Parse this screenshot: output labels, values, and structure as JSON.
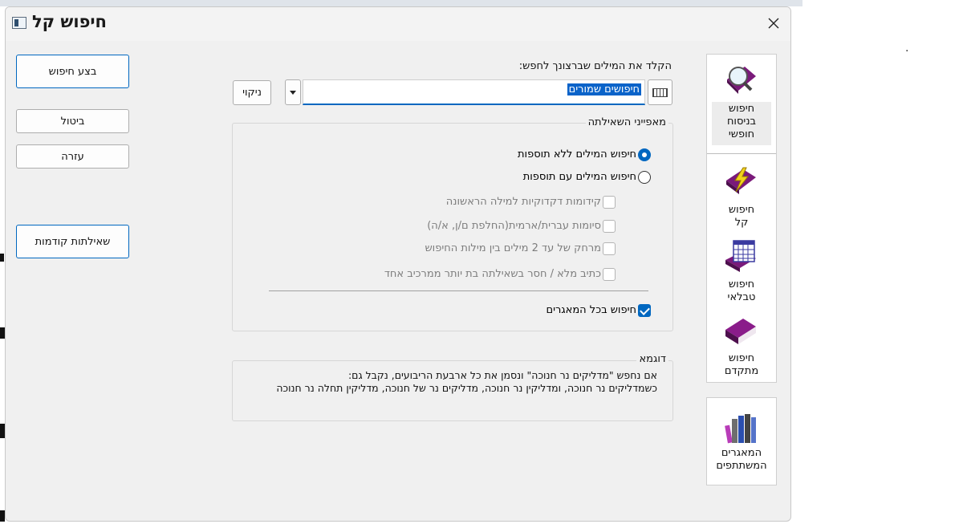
{
  "window": {
    "title": "חיפוש קל"
  },
  "buttons": {
    "run_search": "בצע חיפוש",
    "cancel": "ביטול",
    "help": "עזרה",
    "previous_queries": "שאילתות קודמות",
    "clear": "ניקוי"
  },
  "search": {
    "prompt": "הקלד את המילים שברצונך לחפש:",
    "value": "חיפושים שמורים"
  },
  "query_properties": {
    "title": "מאפייני השאילתה",
    "radios": [
      {
        "label": "חיפוש המילים ללא תוספות",
        "checked": true
      },
      {
        "label": "חיפוש המילים עם תוספות",
        "checked": false
      }
    ],
    "checkboxes": [
      {
        "label": "קידומות דקדוקיות למילה הראשונה",
        "checked": false,
        "enabled": false
      },
      {
        "label": "סיומות עברית/ארמית(החלפת ם/ן, א/ה)",
        "checked": false,
        "enabled": false
      },
      {
        "label": "מרחק של עד 2 מילים בין מילות החיפוש",
        "checked": false,
        "enabled": false
      },
      {
        "label": "כתיב מלא / חסר בשאילתה בת יותר ממרכיב אחד",
        "checked": false,
        "enabled": false
      }
    ],
    "all_databases": {
      "label": "חיפוש בכל המאגרים",
      "checked": true
    }
  },
  "example": {
    "title": "דוגמא",
    "line1": "אם נחפש \"מדליקים נר חנוכה\" ונסמן את כל ארבעת הריבועים, נקבל גם:",
    "line2": "כשמדליקים נר חנוכה, ומדליקין נר חנוכה, מדליקים נר של חנוכה, מדליקין תחלה נר חנוכה"
  },
  "nav": {
    "items": [
      {
        "line1": "חיפוש",
        "line2": "בניסוח",
        "line3": "חופשי",
        "icon": "magnifier-book-icon",
        "selected": true
      },
      {
        "line1": "חיפוש",
        "line2": "קל",
        "line3": "",
        "icon": "lightning-book-icon",
        "selected": false
      },
      {
        "line1": "חיפוש",
        "line2": "טבלאי",
        "line3": "",
        "icon": "table-book-icon",
        "selected": false
      },
      {
        "line1": "חיפוש",
        "line2": "מתקדם",
        "line3": "",
        "icon": "book-icon",
        "selected": false
      }
    ],
    "shared": {
      "line1": "המאגרים",
      "line2": "המשתתפים",
      "icon": "bookshelf-icon"
    }
  },
  "colors": {
    "accent": "#0067c0",
    "book": "#7a1a7a",
    "dialog_bg": "#f0f0f0"
  }
}
